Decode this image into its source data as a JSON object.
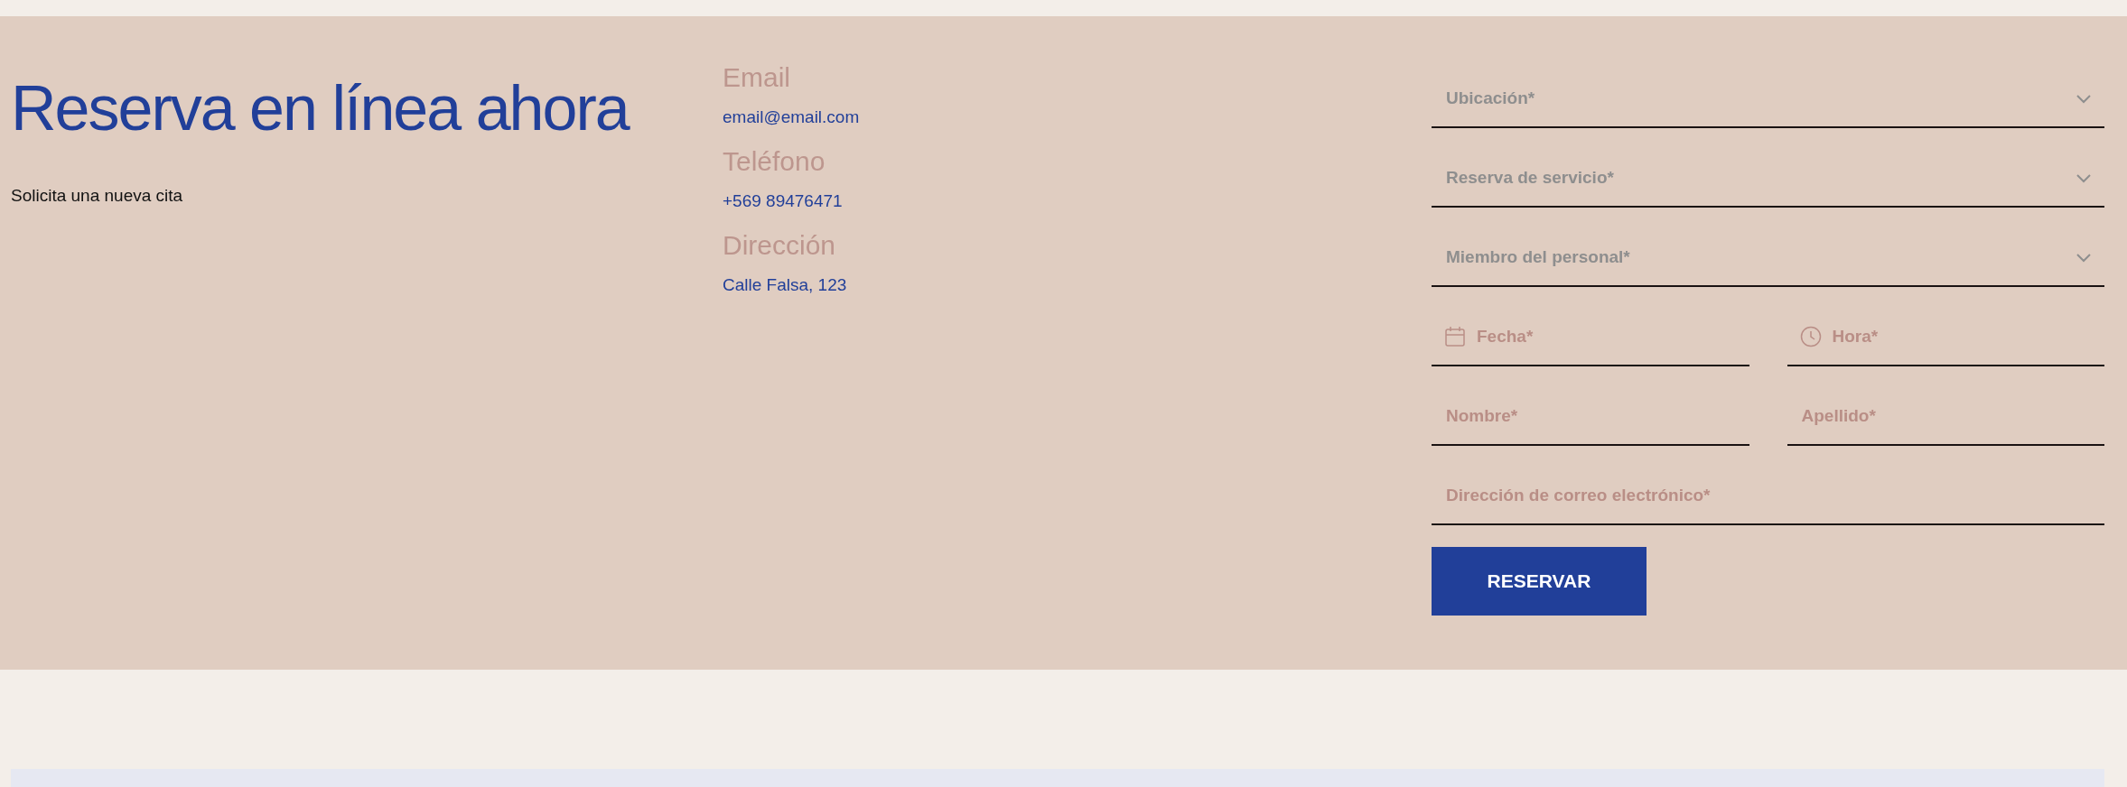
{
  "heading": "Reserva en línea ahora",
  "subtitle": "Solicita una nueva cita",
  "contact": [
    {
      "label": "Email",
      "value": "email@email.com"
    },
    {
      "label": "Teléfono",
      "value": "+569 89476471"
    },
    {
      "label": "Dirección",
      "value": "Calle Falsa, 123"
    }
  ],
  "form": {
    "rows": [
      {
        "fields": [
          {
            "kind": "select",
            "placeholder": "Ubicación*"
          }
        ]
      },
      {
        "fields": [
          {
            "kind": "select",
            "placeholder": "Reserva de servicio*"
          }
        ]
      },
      {
        "fields": [
          {
            "kind": "select",
            "placeholder": "Miembro del personal*"
          }
        ]
      },
      {
        "fields": [
          {
            "kind": "date",
            "placeholder": "Fecha*"
          },
          {
            "kind": "time",
            "placeholder": "Hora*"
          }
        ]
      },
      {
        "fields": [
          {
            "kind": "text",
            "placeholder": "Nombre*"
          },
          {
            "kind": "text",
            "placeholder": "Apellido*"
          }
        ]
      },
      {
        "fields": [
          {
            "kind": "text",
            "placeholder": "Dirección de correo electrónico*"
          }
        ]
      }
    ],
    "submit": "RESERVAR"
  }
}
